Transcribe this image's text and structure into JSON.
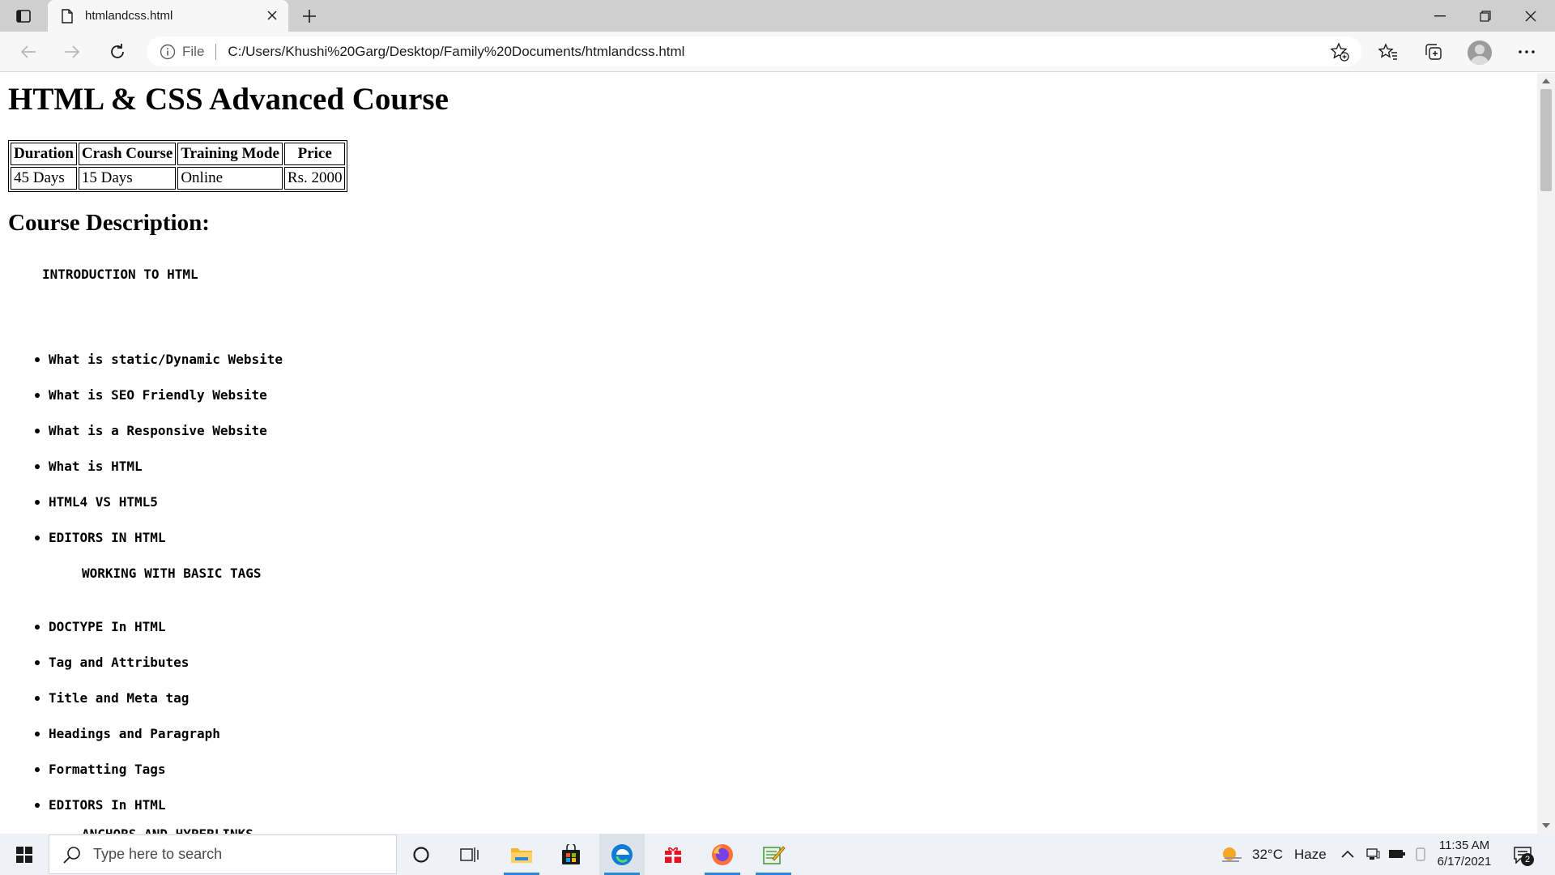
{
  "browser": {
    "tab_title": "htmlandcss.html",
    "address_scheme": "File",
    "address_url": "C:/Users/Khushi%20Garg/Desktop/Family%20Documents/htmlandcss.html"
  },
  "page": {
    "title": "HTML & CSS Advanced Course",
    "table": {
      "headers": [
        "Duration",
        "Crash Course",
        "Training Mode",
        "Price"
      ],
      "rows": [
        [
          "45 Days",
          "15 Days",
          "Online",
          "Rs. 2000"
        ]
      ]
    },
    "description_heading": "Course Description:",
    "sections": [
      {
        "label": "INTRODUCTION TO HTML",
        "items": [
          "What is static/Dynamic Website",
          "What is SEO Friendly Website",
          "What is a Responsive Website",
          "What is HTML",
          "HTML4 VS HTML5",
          "EDITORS IN HTML"
        ]
      },
      {
        "label": "WORKING WITH BASIC TAGS",
        "items": [
          "DOCTYPE In HTML",
          "Tag and Attributes",
          "Title and Meta tag",
          "Headings and Paragraph",
          "Formatting Tags",
          "EDITORS In HTML"
        ]
      },
      {
        "label": "ANCHORS AND HYPERLINKS",
        "items": []
      }
    ]
  },
  "taskbar": {
    "search_placeholder": "Type here to search",
    "weather_temp": "32°C",
    "weather_condition": "Haze",
    "clock_time": "11:35 AM",
    "clock_date": "6/17/2021",
    "notification_count": "2"
  },
  "icons": {
    "tab_actions": "tab-actions-icon",
    "page": "page-icon",
    "close": "close-icon",
    "new_tab": "plus-icon",
    "back": "back-arrow-icon",
    "forward": "forward-arrow-icon",
    "refresh": "refresh-icon",
    "info": "info-icon",
    "add_favorite": "star-plus-icon",
    "favorites": "favorites-icon",
    "collections": "collections-icon",
    "profile": "profile-icon",
    "more": "more-icon",
    "windows": "windows-logo-icon",
    "search": "search-icon",
    "cortana": "cortana-icon",
    "task_view": "task-view-icon",
    "explorer": "file-explorer-icon",
    "store": "store-icon",
    "edge": "edge-icon",
    "gift": "gift-icon",
    "firefox": "firefox-icon",
    "notepad": "notepad-icon",
    "weather": "weather-icon",
    "chevron_up": "chevron-up-icon",
    "network": "network-icon",
    "battery": "battery-icon",
    "notification": "notification-icon"
  },
  "colors": {
    "tab_strip": "#cfcfcf",
    "toolbar": "#f7f7f7",
    "taskbar": "#eef2f6",
    "taskbar_accent": "#2b88d8",
    "edge_blue": "#0f7bd8"
  }
}
